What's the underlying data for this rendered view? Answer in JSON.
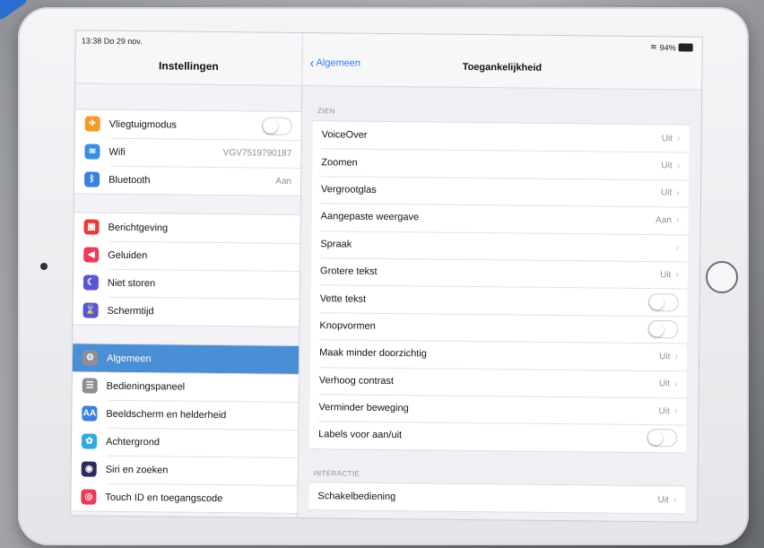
{
  "status": {
    "time_date": "13:38  Do 29 nov.",
    "battery": "94%"
  },
  "left": {
    "title": "Instellingen",
    "group1": [
      {
        "label": "Vliegtuigmodus",
        "value": "",
        "icon": "airplane-icon",
        "color": "#f59a23",
        "glyph": "✈",
        "toggle": true
      },
      {
        "label": "Wifi",
        "value": "VGV7519790187",
        "icon": "wifi-icon",
        "color": "#3b8de0",
        "glyph": "≋"
      },
      {
        "label": "Bluetooth",
        "value": "Aan",
        "icon": "bluetooth-icon",
        "color": "#3b7fe0",
        "glyph": "ᛒ"
      }
    ],
    "group2": [
      {
        "label": "Berichtgeving",
        "icon": "notifications-icon",
        "color": "#ea3b3b",
        "glyph": "▣"
      },
      {
        "label": "Geluiden",
        "icon": "sounds-icon",
        "color": "#ea3b5a",
        "glyph": "◀"
      },
      {
        "label": "Niet storen",
        "icon": "moon-icon",
        "color": "#5b55d6",
        "glyph": "☾"
      },
      {
        "label": "Schermtijd",
        "icon": "hourglass-icon",
        "color": "#5b55d6",
        "glyph": "⌛"
      }
    ],
    "group3": [
      {
        "label": "Algemeen",
        "icon": "gear-icon",
        "color": "#8e8e93",
        "glyph": "⚙",
        "selected": true
      },
      {
        "label": "Bedieningspaneel",
        "icon": "control-center-icon",
        "color": "#8e8e93",
        "glyph": "☰"
      },
      {
        "label": "Beeldscherm en helderheid",
        "icon": "display-icon",
        "color": "#3b7fe0",
        "glyph": "AA"
      },
      {
        "label": "Achtergrond",
        "icon": "wallpaper-icon",
        "color": "#35a7e0",
        "glyph": "✿"
      },
      {
        "label": "Siri en zoeken",
        "icon": "siri-icon",
        "color": "#2c2c5e",
        "glyph": "◉"
      },
      {
        "label": "Touch ID en toegangscode",
        "icon": "fingerprint-icon",
        "color": "#ea3b5a",
        "glyph": "◎"
      }
    ]
  },
  "right": {
    "back_label": "Algemeen",
    "title": "Toegankelijkheid",
    "section1_label": "ZIEN",
    "section2_label": "INTERACTIE",
    "vision": [
      {
        "label": "VoiceOver",
        "value": "Uit",
        "chevron": true
      },
      {
        "label": "Zoomen",
        "value": "Uit",
        "chevron": true
      },
      {
        "label": "Vergrootglas",
        "value": "Uit",
        "chevron": true
      },
      {
        "label": "Aangepaste weergave",
        "value": "Aan",
        "chevron": true
      },
      {
        "label": "Spraak",
        "value": "",
        "chevron": true
      },
      {
        "label": "Grotere tekst",
        "value": "Uit",
        "chevron": true
      },
      {
        "label": "Vette tekst",
        "toggle": true
      },
      {
        "label": "Knopvormen",
        "toggle": true
      },
      {
        "label": "Maak minder doorzichtig",
        "value": "Uit",
        "chevron": true
      },
      {
        "label": "Verhoog contrast",
        "value": "Uit",
        "chevron": true
      },
      {
        "label": "Verminder beweging",
        "value": "Uit",
        "chevron": true
      },
      {
        "label": "Labels voor aan/uit",
        "toggle": true
      }
    ],
    "interaction": [
      {
        "label": "Schakelbediening",
        "value": "Uit",
        "chevron": true
      }
    ]
  }
}
